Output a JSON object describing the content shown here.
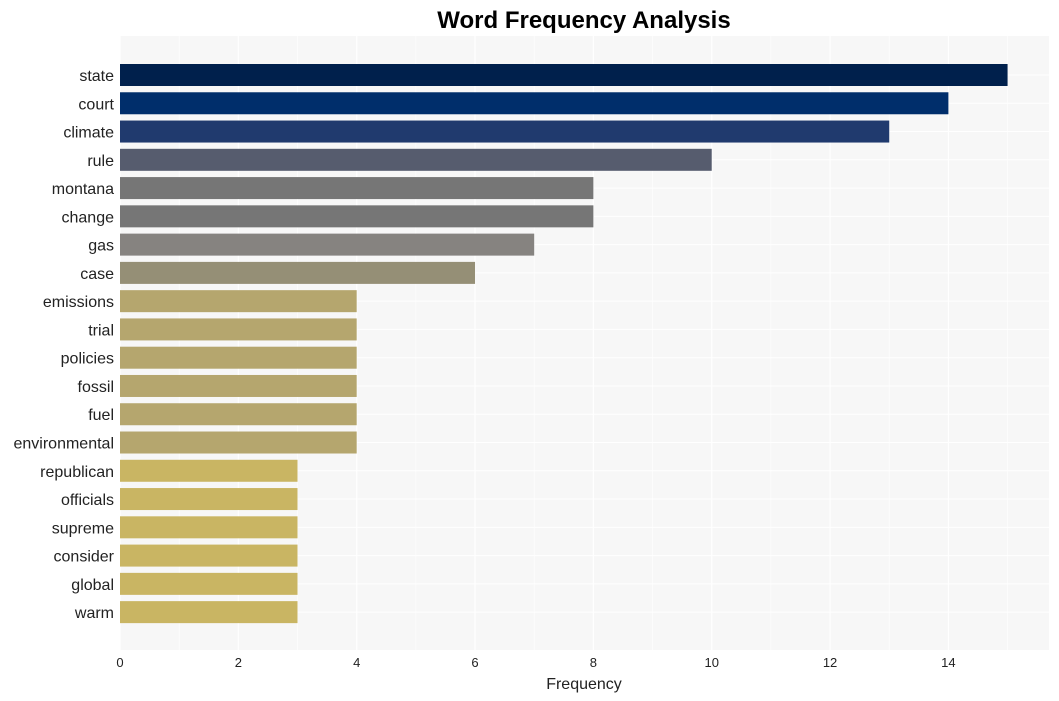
{
  "chart_data": {
    "type": "bar",
    "orientation": "horizontal",
    "title": "Word Frequency Analysis",
    "xlabel": "Frequency",
    "ylabel": "",
    "xlim": [
      0,
      15.7
    ],
    "xticks": [
      0,
      2,
      4,
      6,
      8,
      10,
      12,
      14
    ],
    "grid": true,
    "categories": [
      "state",
      "court",
      "climate",
      "rule",
      "montana",
      "change",
      "gas",
      "case",
      "emissions",
      "trial",
      "policies",
      "fossil",
      "fuel",
      "environmental",
      "republican",
      "officials",
      "supreme",
      "consider",
      "global",
      "warm"
    ],
    "values": [
      15,
      14,
      13,
      10,
      8,
      8,
      7,
      6,
      4,
      4,
      4,
      4,
      4,
      4,
      3,
      3,
      3,
      3,
      3,
      3
    ],
    "colors": [
      "#00204c",
      "#002e6b",
      "#203a6e",
      "#565c6e",
      "#767676",
      "#767676",
      "#868380",
      "#958f76",
      "#b5a66e",
      "#b5a66e",
      "#b5a66e",
      "#b5a66e",
      "#b5a66e",
      "#b5a66e",
      "#c9b563",
      "#c9b563",
      "#c9b563",
      "#c9b563",
      "#c9b563",
      "#c9b563"
    ],
    "plot_background": "#f7f7f7",
    "gridline_color": "#ffffff"
  }
}
